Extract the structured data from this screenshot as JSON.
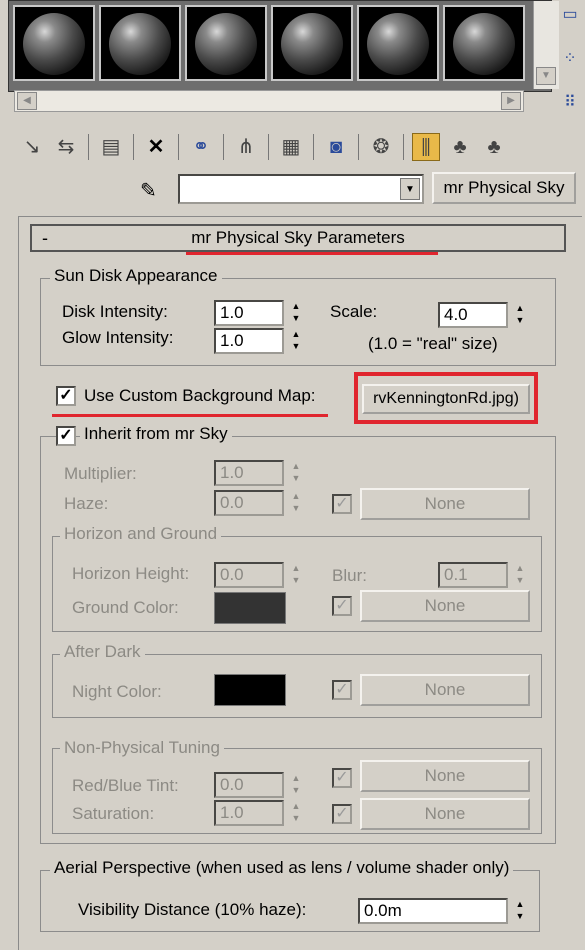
{
  "toolbar": {
    "icons": [
      "get-material-icon",
      "put-to-scene-icon",
      "assign-material-icon",
      "delete-icon",
      "make-unique-icon",
      "put-to-library-icon",
      "material-id-icon",
      "show-map-icon",
      "show-end-result-icon",
      "go-to-parent-icon",
      "go-forward-icon"
    ]
  },
  "material": {
    "name_value": "",
    "type_label": "mr Physical Sky"
  },
  "rollout": {
    "collapse_glyph": "-",
    "title": "mr Physical Sky Parameters"
  },
  "sun_disk": {
    "group_label": "Sun Disk Appearance",
    "disk_intensity_label": "Disk Intensity:",
    "disk_intensity_value": "1.0",
    "glow_intensity_label": "Glow Intensity:",
    "glow_intensity_value": "1.0",
    "scale_label": "Scale:",
    "scale_value": "4.0",
    "scale_note": "(1.0 = \"real\" size)"
  },
  "custom_bg": {
    "checkbox_label": "Use Custom Background Map:",
    "checked": true,
    "map_name": "rvKenningtonRd.jpg)"
  },
  "inherit": {
    "checkbox_label": "Inherit from mr Sky",
    "checked": true,
    "multiplier_label": "Multiplier:",
    "multiplier_value": "1.0",
    "haze_label": "Haze:",
    "haze_value": "0.0",
    "haze_map": "None"
  },
  "horizon": {
    "group_label": "Horizon and Ground",
    "height_label": "Horizon Height:",
    "height_value": "0.0",
    "blur_label": "Blur:",
    "blur_value": "0.1",
    "ground_color_label": "Ground Color:",
    "ground_color": "#333333",
    "ground_map": "None"
  },
  "after_dark": {
    "group_label": "After Dark",
    "night_color_label": "Night Color:",
    "night_color": "#000000",
    "night_map": "None"
  },
  "non_physical": {
    "group_label": "Non-Physical Tuning",
    "tint_label": "Red/Blue Tint:",
    "tint_value": "0.0",
    "tint_map": "None",
    "saturation_label": "Saturation:",
    "saturation_value": "1.0",
    "saturation_map": "None"
  },
  "aerial": {
    "group_label": "Aerial Perspective (when used as lens / volume shader only)",
    "visibility_label": "Visibility Distance (10% haze):",
    "visibility_value": "0.0m"
  },
  "colors": {
    "highlight_red": "#e0252e",
    "panel_bg": "#d4d0c8",
    "active_button": "#e9b949"
  }
}
